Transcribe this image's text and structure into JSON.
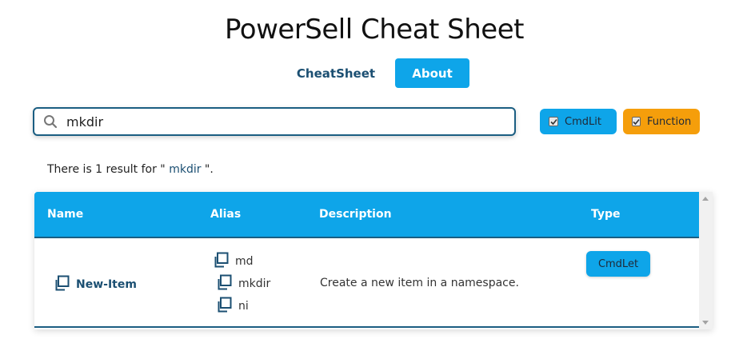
{
  "header": {
    "title": "PowerSell Cheat Sheet"
  },
  "tabs": [
    {
      "label": "CheatSheet",
      "active": false
    },
    {
      "label": "About",
      "active": true
    }
  ],
  "search": {
    "value": "mkdir",
    "icon": "search-icon"
  },
  "filters": [
    {
      "label": "CmdLit",
      "checked": true,
      "color": "#0ea5e9"
    },
    {
      "label": "Function",
      "checked": true,
      "color": "#f59e0b"
    }
  ],
  "result": {
    "prefix": "There is 1 result for \" ",
    "query": "mkdir",
    "suffix": " \"."
  },
  "table": {
    "headers": {
      "name": "Name",
      "alias": "Alias",
      "description": "Description",
      "type": "Type"
    },
    "rows": [
      {
        "name": "New-Item",
        "aliases": [
          "md",
          "mkdir",
          "ni"
        ],
        "description": "Create a new item in a namespace.",
        "type": "CmdLet"
      }
    ]
  },
  "colors": {
    "accent": "#0ea5e9",
    "dark": "#1b4f72",
    "function": "#f59e0b"
  }
}
